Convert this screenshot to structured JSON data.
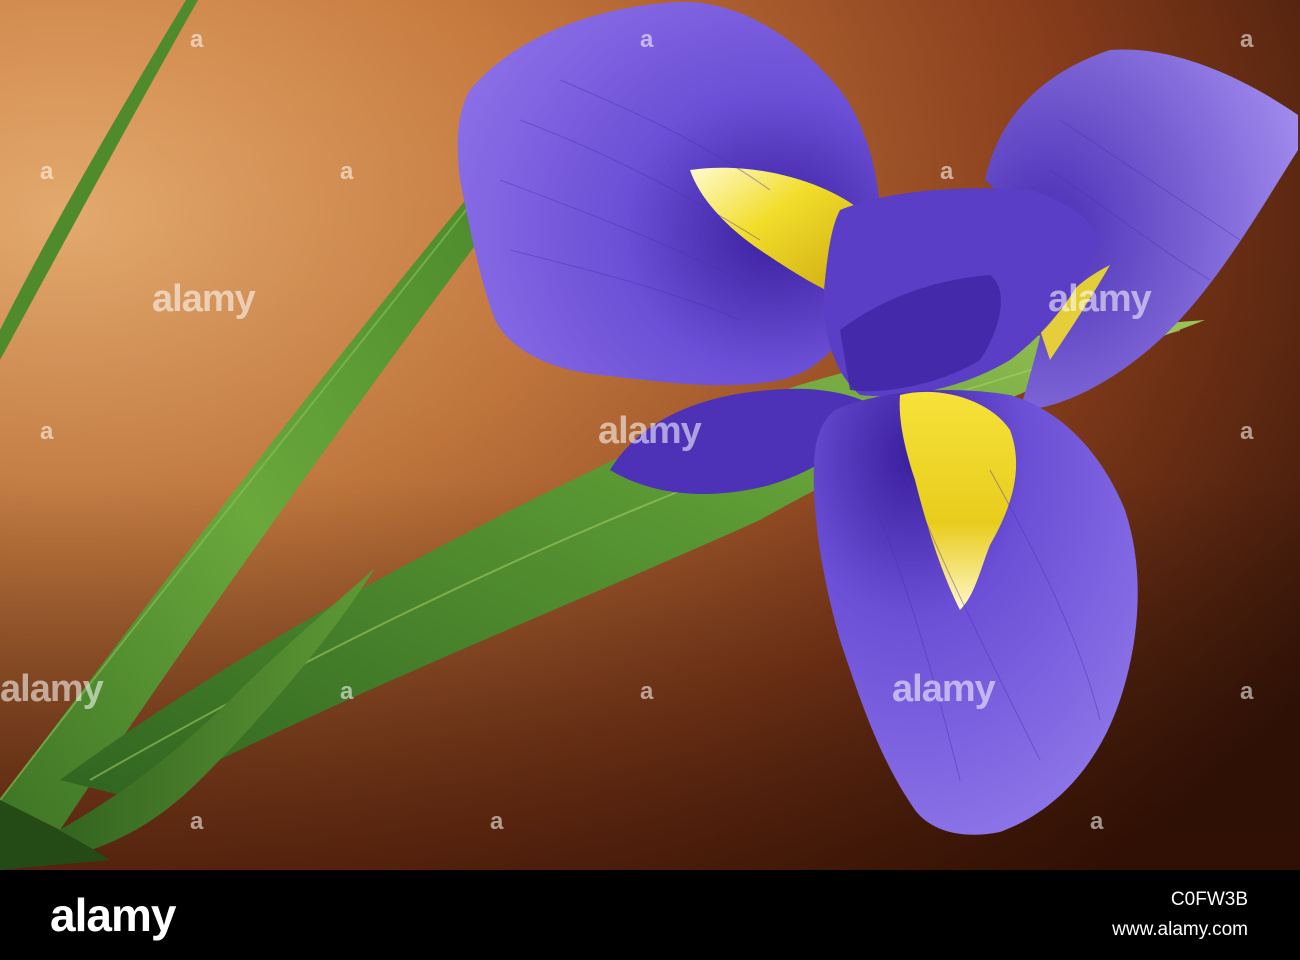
{
  "watermark": {
    "word": "alamy",
    "mark": "a"
  },
  "footer": {
    "logo": "alamy",
    "image_id": "C0FW3B",
    "url": "www.alamy.com"
  },
  "colors": {
    "background_light": "#dc9d63",
    "background_dark": "#3a1608",
    "petal_violet": "#6b4fd6",
    "petal_dark": "#3a1f9e",
    "petal_signal": "#f2dd2a",
    "leaf_green": "#5f9a35",
    "leaf_dark": "#2c5a1c",
    "footer_bg": "#000000"
  }
}
